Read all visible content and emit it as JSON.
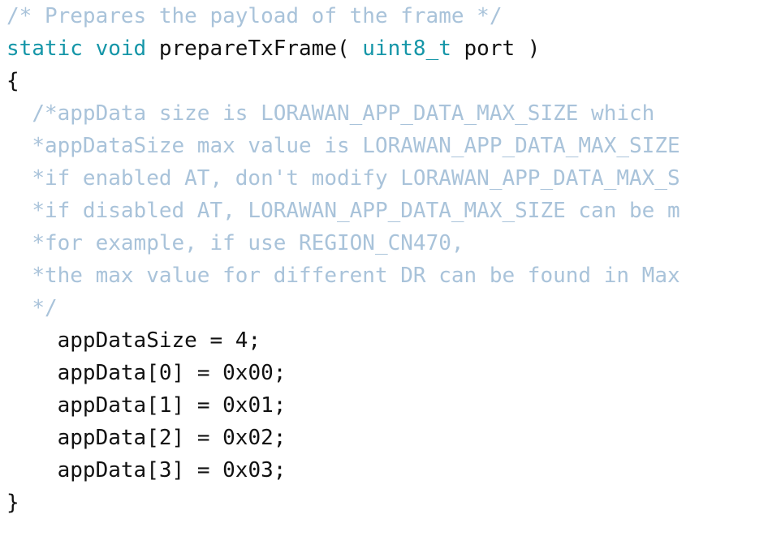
{
  "editor": {
    "background_color": "#ffffff",
    "comment_color": "#a9c3da",
    "keyword_color": "#1596a8",
    "text_color": "#111111",
    "language": "c"
  },
  "code": {
    "lines": [
      {
        "id": "line-1",
        "indent": "",
        "tokens": [
          {
            "kind": "comment",
            "text": "/* Prepares the payload of the frame */"
          }
        ]
      },
      {
        "id": "line-2",
        "indent": "",
        "tokens": [
          {
            "kind": "keyword",
            "text": "static void"
          },
          {
            "kind": "plain",
            "text": " prepareTxFrame( "
          },
          {
            "kind": "type",
            "text": "uint8_t"
          },
          {
            "kind": "plain",
            "text": " port )"
          }
        ]
      },
      {
        "id": "line-3",
        "indent": "",
        "tokens": [
          {
            "kind": "punct",
            "text": "{"
          }
        ]
      },
      {
        "id": "line-4",
        "indent": "  ",
        "tokens": [
          {
            "kind": "comment",
            "text": "/*appData size is LORAWAN_APP_DATA_MAX_SIZE which "
          }
        ]
      },
      {
        "id": "line-5",
        "indent": "  ",
        "tokens": [
          {
            "kind": "comment",
            "text": "*appDataSize max value is LORAWAN_APP_DATA_MAX_SIZE"
          }
        ]
      },
      {
        "id": "line-6",
        "indent": "  ",
        "tokens": [
          {
            "kind": "comment",
            "text": "*if enabled AT, don't modify LORAWAN_APP_DATA_MAX_S"
          }
        ]
      },
      {
        "id": "line-7",
        "indent": "  ",
        "tokens": [
          {
            "kind": "comment",
            "text": "*if disabled AT, LORAWAN_APP_DATA_MAX_SIZE can be m"
          }
        ]
      },
      {
        "id": "line-8",
        "indent": "  ",
        "tokens": [
          {
            "kind": "comment",
            "text": "*for example, if use REGION_CN470,"
          }
        ]
      },
      {
        "id": "line-9",
        "indent": "  ",
        "tokens": [
          {
            "kind": "comment",
            "text": "*the max value for different DR can be found in Max"
          }
        ]
      },
      {
        "id": "line-10",
        "indent": "  ",
        "tokens": [
          {
            "kind": "comment",
            "text": "*/"
          }
        ]
      },
      {
        "id": "line-11",
        "indent": "    ",
        "tokens": [
          {
            "kind": "plain",
            "text": "appDataSize = "
          },
          {
            "kind": "number",
            "text": "4"
          },
          {
            "kind": "punct",
            "text": ";"
          }
        ]
      },
      {
        "id": "line-12",
        "indent": "    ",
        "tokens": [
          {
            "kind": "plain",
            "text": "appData["
          },
          {
            "kind": "number",
            "text": "0"
          },
          {
            "kind": "plain",
            "text": "] = "
          },
          {
            "kind": "number",
            "text": "0x00"
          },
          {
            "kind": "punct",
            "text": ";"
          }
        ]
      },
      {
        "id": "line-13",
        "indent": "    ",
        "tokens": [
          {
            "kind": "plain",
            "text": "appData["
          },
          {
            "kind": "number",
            "text": "1"
          },
          {
            "kind": "plain",
            "text": "] = "
          },
          {
            "kind": "number",
            "text": "0x01"
          },
          {
            "kind": "punct",
            "text": ";"
          }
        ]
      },
      {
        "id": "line-14",
        "indent": "    ",
        "tokens": [
          {
            "kind": "plain",
            "text": "appData["
          },
          {
            "kind": "number",
            "text": "2"
          },
          {
            "kind": "plain",
            "text": "] = "
          },
          {
            "kind": "number",
            "text": "0x02"
          },
          {
            "kind": "punct",
            "text": ";"
          }
        ]
      },
      {
        "id": "line-15",
        "indent": "    ",
        "tokens": [
          {
            "kind": "plain",
            "text": "appData["
          },
          {
            "kind": "number",
            "text": "3"
          },
          {
            "kind": "plain",
            "text": "] = "
          },
          {
            "kind": "number",
            "text": "0x03"
          },
          {
            "kind": "punct",
            "text": ";"
          }
        ]
      },
      {
        "id": "line-16",
        "indent": "",
        "tokens": [
          {
            "kind": "punct",
            "text": "}"
          }
        ]
      }
    ]
  }
}
